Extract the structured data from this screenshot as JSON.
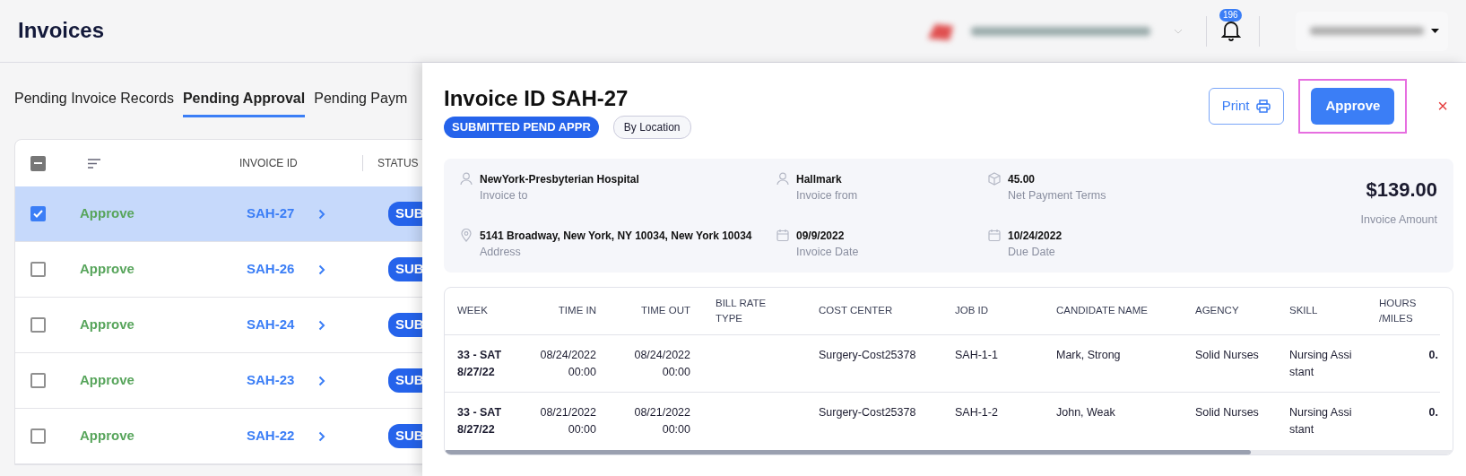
{
  "header": {
    "title": "Invoices",
    "notifications": "196"
  },
  "tabs": [
    {
      "label": "Pending Invoice Records",
      "selected": false
    },
    {
      "label": "Pending Approval",
      "selected": true
    },
    {
      "label": "Pending Paym",
      "selected": false
    }
  ],
  "list": {
    "indeterminate": true,
    "columns": [
      "INVOICE ID",
      "STATUS"
    ],
    "rows": [
      {
        "action": "Approve",
        "invoice_id": "SAH-27",
        "status": "SUB",
        "checked": true,
        "highlighted": true
      },
      {
        "action": "Approve",
        "invoice_id": "SAH-26",
        "status": "SUB",
        "checked": false,
        "highlighted": false
      },
      {
        "action": "Approve",
        "invoice_id": "SAH-24",
        "status": "SUB",
        "checked": false,
        "highlighted": false
      },
      {
        "action": "Approve",
        "invoice_id": "SAH-23",
        "status": "SUB",
        "checked": false,
        "highlighted": false
      },
      {
        "action": "Approve",
        "invoice_id": "SAH-22",
        "status": "SUB",
        "checked": false,
        "highlighted": false
      }
    ]
  },
  "panel": {
    "title": "Invoice ID SAH-27",
    "status": "SUBMITTED PEND APPR",
    "tag": "By Location",
    "print": "Print",
    "approve": "Approve",
    "approve_highlighted": true,
    "close": "×",
    "fields": [
      {
        "kind": "person",
        "value": "NewYork-Presbyterian Hospital",
        "label": "Invoice to"
      },
      {
        "kind": "person",
        "value": "Hallmark",
        "label": "Invoice from"
      },
      {
        "kind": "box",
        "value": "45.00",
        "label": "Net Payment Terms"
      },
      {
        "kind": "location",
        "value": "5141 Broadway, New York, NY 10034, New York 10034",
        "label": "Address"
      },
      {
        "kind": "calendar",
        "value": "09/9/2022",
        "label": "Invoice Date"
      },
      {
        "kind": "calendar",
        "value": "10/24/2022",
        "label": "Due Date"
      }
    ],
    "amount": {
      "value": "$139.00",
      "label": "Invoice Amount"
    },
    "table": {
      "columns": [
        "WEEK",
        "TIME IN",
        "TIME OUT",
        "BILL RATE TYPE",
        "COST CENTER",
        "JOB ID",
        "CANDIDATE NAME",
        "AGENCY",
        "SKILL",
        "HOURS /MILES"
      ],
      "rows": [
        [
          "33 - SAT 8/27/22",
          "08/24/2022 00:00",
          "08/24/2022 00:00",
          null,
          "Surgery-Cost25378",
          "SAH-1-1",
          "Mark, Strong",
          "Solid Nurses",
          "Nursing Assistant",
          "0."
        ],
        [
          "33 - SAT 8/27/22",
          "08/21/2022 00:00",
          "08/21/2022 00:00",
          null,
          "Surgery-Cost25378",
          "SAH-1-2",
          "John, Weak",
          "Solid Nurses",
          "Nursing Assistant",
          "0."
        ]
      ]
    }
  }
}
